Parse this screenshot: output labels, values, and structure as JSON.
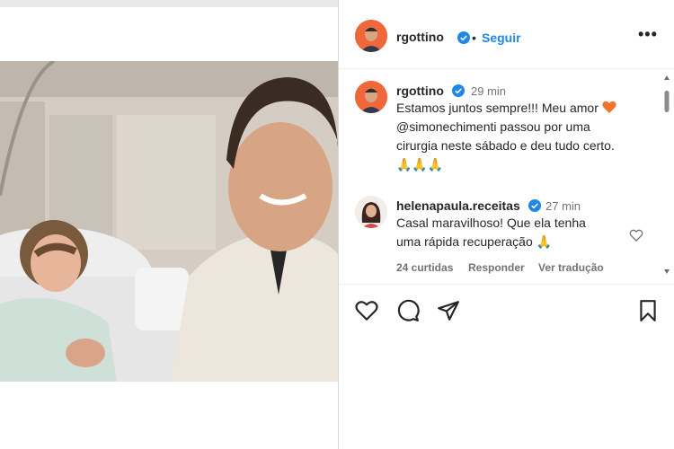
{
  "post": {
    "author": "rgottino",
    "follow_label": "Seguir",
    "separator": "•",
    "more_label": "•••",
    "caption": {
      "author": "rgottino",
      "time": "29 min",
      "line1": "Estamos juntos sempre!!! Meu amor",
      "mention": "@simonechimenti",
      "line2_rest": " passou por uma",
      "line3": "cirurgia neste sábado e deu tudo certo.",
      "emojis": "🙏🙏🙏"
    },
    "comment": {
      "author": "helenapaula.receitas",
      "time": "27 min",
      "line1": "Casal maravilhoso! Que ela tenha",
      "line2": "uma rápida recuperação 🙏",
      "likes": "24 curtidas",
      "reply": "Responder",
      "translate": "Ver tradução"
    }
  },
  "icons": {
    "verified": "verified-badge-icon",
    "like": "heart-icon",
    "comment": "comment-icon",
    "share": "share-icon",
    "save": "bookmark-icon",
    "more": "more-options-icon"
  },
  "colors": {
    "accent": "#1f87e5",
    "text": "#262626",
    "muted": "#737373",
    "avatar_bg": "#f0673c",
    "heart_emoji": "#f0742a"
  }
}
